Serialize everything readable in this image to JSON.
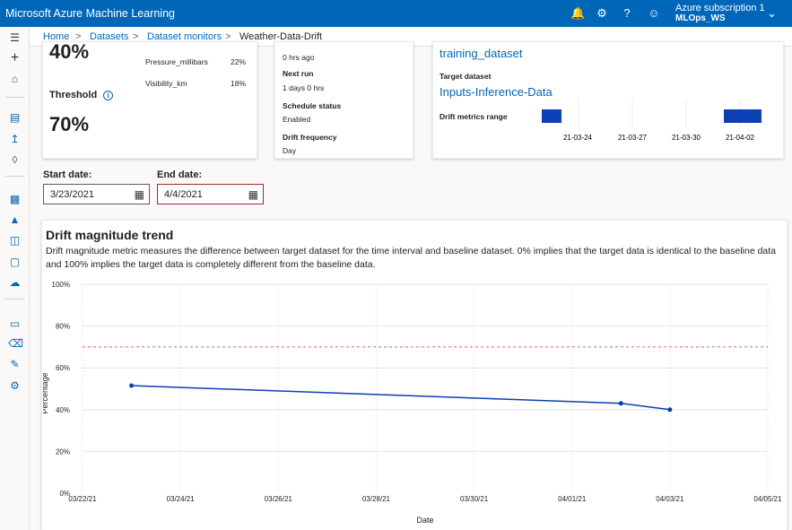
{
  "app": {
    "title": "Microsoft Azure Machine Learning",
    "subscription": "Azure subscription 1",
    "workspace": "MLOps_WS"
  },
  "breadcrumb": {
    "home": "Home",
    "datasets": "Datasets",
    "monitors": "Dataset monitors",
    "current": "Weather-Data-Drift"
  },
  "summary": {
    "drift_value": "40%",
    "features": [
      {
        "name": "Pressure_millibars",
        "value": "22%"
      },
      {
        "name": "Visibility_km",
        "value": "18%"
      }
    ],
    "threshold_label": "Threshold",
    "threshold_value": "70%"
  },
  "schedule": {
    "last_run_value": "0 hrs ago",
    "next_run_label": "Next run",
    "next_run_value": "1 days 0 hrs",
    "status_label": "Schedule status",
    "status_value": "Enabled",
    "frequency_label": "Drift frequency",
    "frequency_value": "Day"
  },
  "datasets": {
    "baseline_name": "training_dataset",
    "target_label": "Target dataset",
    "target_name": "Inputs-Inference-Data",
    "range_label": "Drift metrics range",
    "range_ticks": [
      "21-03-24",
      "21-03-27",
      "21-03-30",
      "21-04-02"
    ]
  },
  "filters": {
    "start_label": "Start date:",
    "start_value": "3/23/2021",
    "end_label": "End date:",
    "end_value": "4/4/2021"
  },
  "trend": {
    "title": "Drift magnitude trend",
    "description": "Drift magnitude metric measures the difference between target dataset for the time interval and baseline dataset. 0% implies that the target data is identical to the baseline data and 100% implies the target data is completely different from the baseline data."
  },
  "chart_data": {
    "type": "line",
    "xlabel": "Date",
    "ylabel": "Percentage",
    "x_ticks": [
      "03/22/21",
      "03/24/21",
      "03/26/21",
      "03/28/21",
      "03/30/21",
      "04/01/21",
      "04/03/21",
      "04/05/21"
    ],
    "y_ticks": [
      "0%",
      "20%",
      "40%",
      "60%",
      "80%",
      "100%"
    ],
    "ylim": [
      0,
      100
    ],
    "xlim_days": [
      0,
      14
    ],
    "threshold": 70,
    "series": [
      {
        "x": [
          "03/23/21",
          "04/02/21",
          "04/03/21"
        ],
        "x_days": [
          1,
          11,
          12
        ],
        "y": [
          51.5,
          43,
          40
        ]
      }
    ],
    "colors": {
      "line": "#0b3fb3",
      "threshold": "#e06666",
      "grid": "#e6e6e6"
    }
  }
}
